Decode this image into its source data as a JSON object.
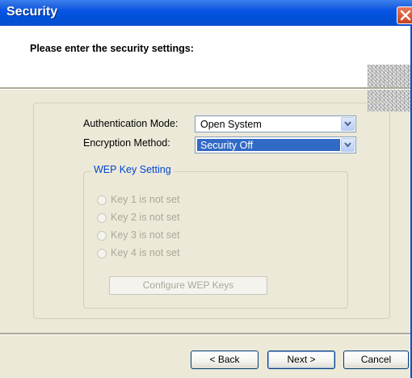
{
  "window": {
    "title": "Security"
  },
  "header": {
    "prompt": "Please enter the security settings:"
  },
  "settings": {
    "auth_label": "Authentication Mode:",
    "auth_value": "Open System",
    "enc_label": "Encryption Method:",
    "enc_value": "Security Off"
  },
  "wep": {
    "legend": "WEP Key Setting",
    "keys": [
      "Key 1 is not set",
      "Key 2 is not set",
      "Key 3 is not set",
      "Key 4 is not set"
    ],
    "configure_label": "Configure WEP Keys"
  },
  "footer": {
    "back_label": "< Back",
    "next_label": "Next >",
    "cancel_label": "Cancel"
  },
  "icons": {
    "close": "close-icon",
    "dropdown": "chevron-down-icon"
  },
  "colors": {
    "titlebar": "#0055E5",
    "selection": "#316AC5",
    "legend": "#0046D5",
    "face": "#ECE9D8"
  }
}
